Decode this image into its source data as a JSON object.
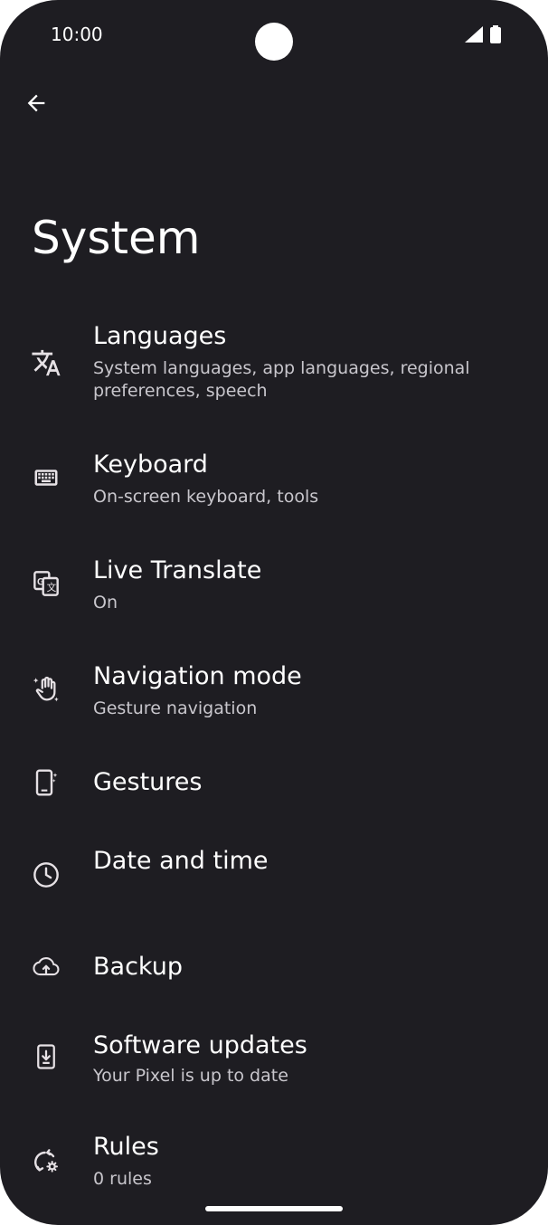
{
  "status_bar": {
    "time": "10:00"
  },
  "header": {
    "back_label": "Back",
    "title": "System"
  },
  "items": [
    {
      "label": "Languages",
      "summary": "System languages, app languages, regional preferences, speech",
      "icon": "translate-icon"
    },
    {
      "label": "Keyboard",
      "summary": "On-screen keyboard, tools",
      "icon": "keyboard-icon"
    },
    {
      "label": "Live Translate",
      "summary": "On",
      "icon": "g-translate-icon"
    },
    {
      "label": "Navigation mode",
      "summary": "Gesture navigation",
      "icon": "gesture-hand-icon"
    },
    {
      "label": "Gestures",
      "summary": "",
      "icon": "phone-gesture-icon"
    },
    {
      "label": "Date and time",
      "summary": "",
      "icon": "clock-icon"
    },
    {
      "label": "Backup",
      "summary": "",
      "icon": "cloud-upload-icon"
    },
    {
      "label": "Software updates",
      "summary": "Your Pixel is up to date",
      "icon": "system-update-icon"
    },
    {
      "label": "Rules",
      "summary": "0 rules",
      "icon": "rules-icon"
    }
  ],
  "colors": {
    "background": "#1e1d22",
    "text": "#ffffff",
    "secondary_text": "#c8c6cc"
  }
}
